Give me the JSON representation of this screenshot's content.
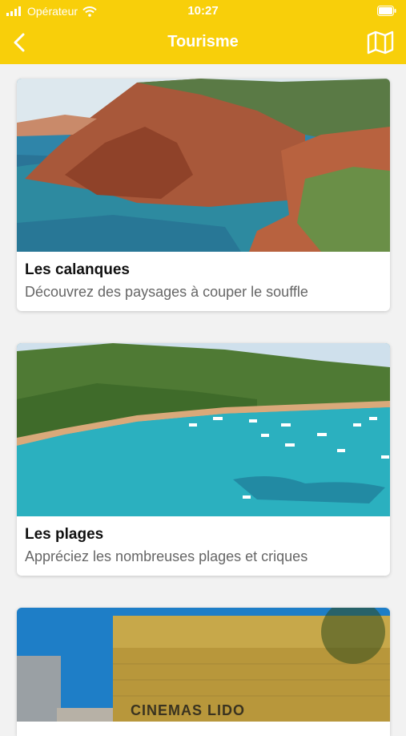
{
  "status": {
    "carrier": "Opérateur",
    "time": "10:27",
    "icons": [
      "signal-icon",
      "wifi-icon",
      "battery-icon"
    ]
  },
  "nav": {
    "title": "Tourisme",
    "back_icon": "chevron-left-icon",
    "map_icon": "map-icon"
  },
  "cards": [
    {
      "title": "Les calanques",
      "subtitle": "Découvrez des paysages à couper le souffle"
    },
    {
      "title": "Les plages",
      "subtitle": "Appréciez les nombreuses plages et criques"
    },
    {
      "image_text": "CINEMAS LIDO"
    }
  ],
  "colors": {
    "accent": "#f8cf0a",
    "card_bg": "#ffffff",
    "page_bg": "#f2f2f2"
  }
}
